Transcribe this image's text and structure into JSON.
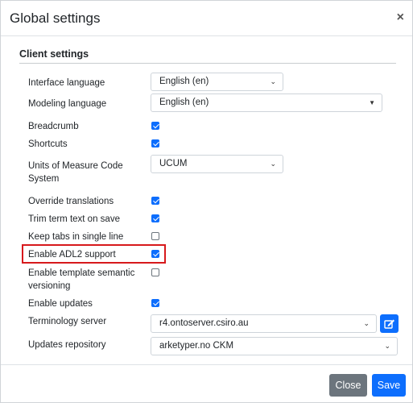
{
  "dialog": {
    "title": "Global settings",
    "close_icon": "×"
  },
  "section": {
    "title": "Client settings"
  },
  "settings": {
    "interface_language": {
      "label": "Interface language",
      "value": "English (en)"
    },
    "modeling_language": {
      "label": "Modeling language",
      "value": "English (en)"
    },
    "breadcrumb": {
      "label": "Breadcrumb",
      "checked": true
    },
    "shortcuts": {
      "label": "Shortcuts",
      "checked": true
    },
    "units_system": {
      "label_line1": "Units of Measure Code",
      "label_line2": "System",
      "value": "UCUM"
    },
    "override_translations": {
      "label": "Override translations",
      "checked": true
    },
    "trim_term_text": {
      "label": "Trim term text on save",
      "checked": true
    },
    "keep_tabs": {
      "label": "Keep tabs in single line",
      "checked": false
    },
    "enable_adl2": {
      "label": "Enable ADL2 support",
      "checked": true
    },
    "template_versioning": {
      "label_line1": "Enable template semantic",
      "label_line2": "versioning",
      "checked": false
    },
    "enable_updates": {
      "label": "Enable updates",
      "checked": true
    },
    "terminology_server": {
      "label": "Terminology server",
      "value": "r4.ontoserver.csiro.au"
    },
    "updates_repository": {
      "label": "Updates repository",
      "value": "arketyper.no CKM"
    }
  },
  "icons": {
    "chevron": "chevron-down-icon",
    "edit": "edit-icon"
  },
  "colors": {
    "primary": "#0d6efd",
    "secondary": "#6c757d",
    "highlight": "#d7191c"
  },
  "footer": {
    "close_label": "Close",
    "save_label": "Save"
  }
}
